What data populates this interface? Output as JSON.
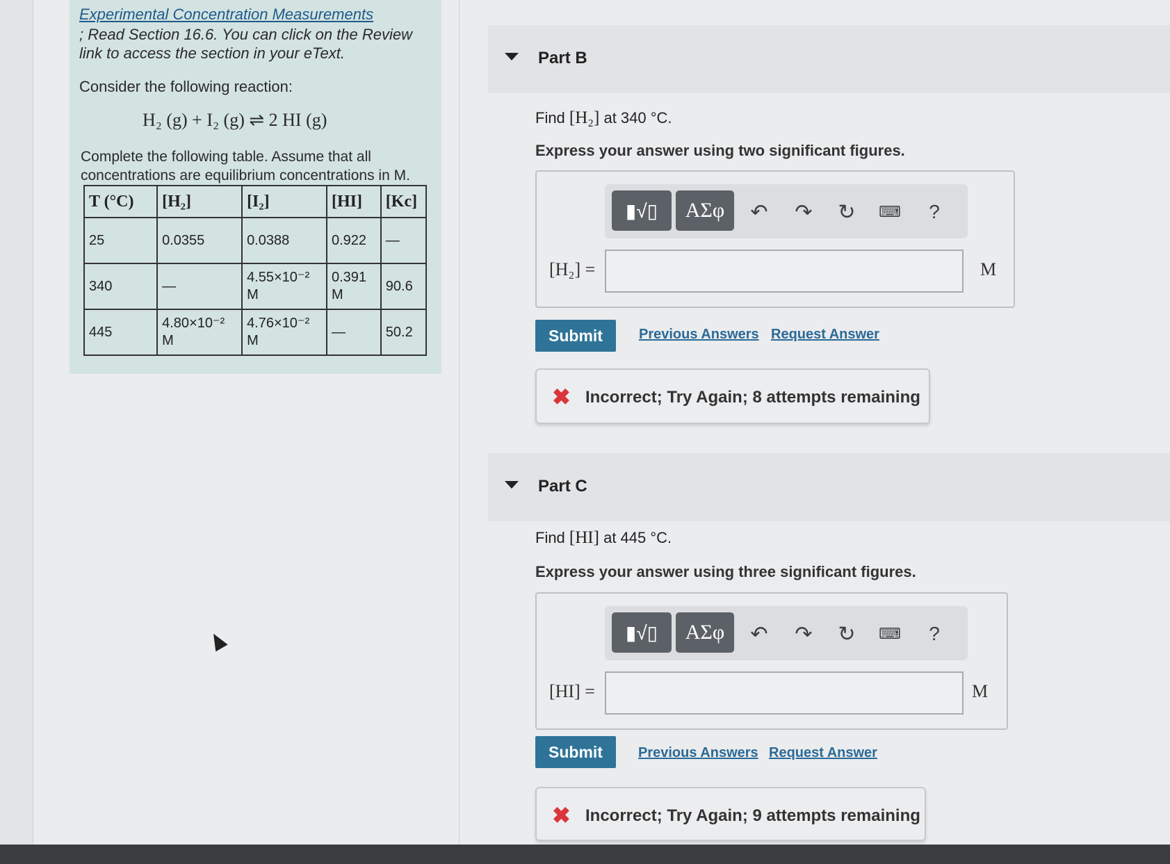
{
  "intro": {
    "review_link": "Experimental Concentration Measurements",
    "review_text": "; Read Section 16.6. You can click on the Review link to access the section in your eText.",
    "consider": "Consider the following reaction:",
    "equation": "H₂ (g) + I₂ (g) ⇌ 2 HI (g)",
    "instructions": "Complete the following table. Assume that all concentrations are equilibrium concentrations in M."
  },
  "table": {
    "headers": [
      "T (°C)",
      "[H₂]",
      "[I₂]",
      "[HI]",
      "[Kc]"
    ],
    "rows": [
      [
        "25",
        "0.0355",
        "0.0388",
        "0.922",
        "—"
      ],
      [
        "340",
        "—",
        "4.55×10⁻² M",
        "0.391 M",
        "90.6"
      ],
      [
        "445",
        "4.80×10⁻² M",
        "4.76×10⁻² M",
        "—",
        "50.2"
      ]
    ]
  },
  "toolbar": {
    "templates_label": "▮√▯",
    "symbols_label": "ΑΣφ",
    "undo_icon": "↶",
    "redo_icon": "↷",
    "reset_icon": "↻",
    "keyboard_icon": "⌨",
    "help_label": "?"
  },
  "part_b": {
    "title": "Part B",
    "find_prefix": "Find",
    "find_math": "[H₂]",
    "find_suffix": "at 340 °C.",
    "express": "Express your answer using two significant figures.",
    "answer_label": "[H₂] =",
    "answer_value": "",
    "unit": "M",
    "submit": "Submit",
    "previous_answers": "Previous Answers",
    "request_answer": "Request Answer",
    "feedback_icon": "✖",
    "feedback": "Incorrect; Try Again; 8 attempts remaining"
  },
  "part_c": {
    "title": "Part C",
    "find_prefix": "Find",
    "find_math": "[HI]",
    "find_suffix": "at 445 °C.",
    "express": "Express your answer using three significant figures.",
    "answer_label": "[HI] =",
    "answer_value": "",
    "unit": "M",
    "submit": "Submit",
    "previous_answers": "Previous Answers",
    "request_answer": "Request Answer",
    "feedback_icon": "✖",
    "feedback": "Incorrect; Try Again; 9 attempts remaining"
  },
  "colors": {
    "intro_bg": "#d3e3e1",
    "submit_bg": "#2f7498",
    "link": "#2b6a97",
    "error": "#d9353b"
  }
}
